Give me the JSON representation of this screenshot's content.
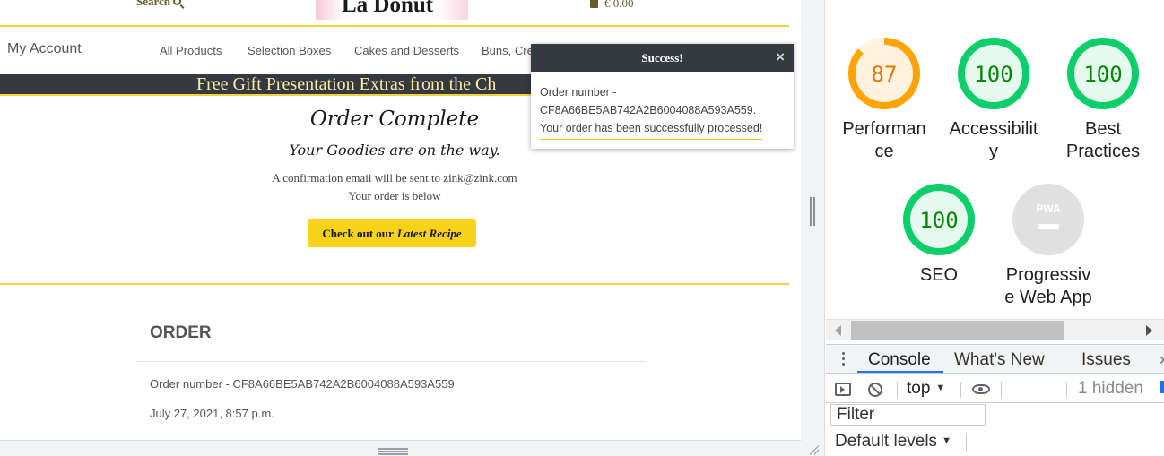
{
  "site": {
    "header": {
      "search_label": "Search",
      "logo_text": "La Donut",
      "cart_total": "€ 0.00"
    },
    "nav": {
      "my_account": "My Account",
      "items": [
        "All Products",
        "Selection Boxes",
        "Cakes and Desserts",
        "Buns, Cre"
      ]
    },
    "banner_text": "Free Gift Presentation Extras from the Ch",
    "order_complete": {
      "title": "Order Complete",
      "subtitle": "Your Goodies are on the way.",
      "email_line": "A confirmation email will be sent to zink@zink.com",
      "below_line": "Your order is below",
      "recipe_button_prefix": "Check out our",
      "recipe_button_emphasis": "Latest Recipe"
    },
    "order": {
      "heading": "ORDER",
      "number_line": "Order number - CF8A66BE5AB742A2B6004088A593A559",
      "date_line": "July 27, 2021, 8:57 p.m."
    },
    "toast": {
      "title": "Success!",
      "close_glyph": "×",
      "line1": "Order number -",
      "line2": "CF8A66BE5AB742A2B6004088A593A559.",
      "line3": "Your order has been successfully processed!"
    }
  },
  "devtools": {
    "lighthouse": {
      "gauges": [
        {
          "score": "87",
          "label": "Performan\nce",
          "value": 0.87,
          "status": "average",
          "color": "#ffa400",
          "fill": "#fff3e0"
        },
        {
          "score": "100",
          "label": "Accessibilit\ny",
          "value": 1.0,
          "status": "pass",
          "color": "#0cce6b",
          "fill": "#e6f9ef"
        },
        {
          "score": "100",
          "label": "Best\nPractices",
          "value": 1.0,
          "status": "pass",
          "color": "#0cce6b",
          "fill": "#e6f9ef"
        },
        {
          "score": "100",
          "label": "SEO",
          "value": 1.0,
          "status": "pass",
          "color": "#0cce6b",
          "fill": "#e6f9ef"
        }
      ],
      "pwa": {
        "badge_text": "PWA",
        "label": "Progressiv\ne Web App"
      }
    },
    "drawer": {
      "tabs": [
        "Console",
        "What's New",
        "Issues"
      ],
      "active_tab": "Console"
    },
    "console": {
      "context": "top",
      "hidden_count": "1 hidden",
      "filter_placeholder": "Filter",
      "levels": "Default levels"
    }
  }
}
